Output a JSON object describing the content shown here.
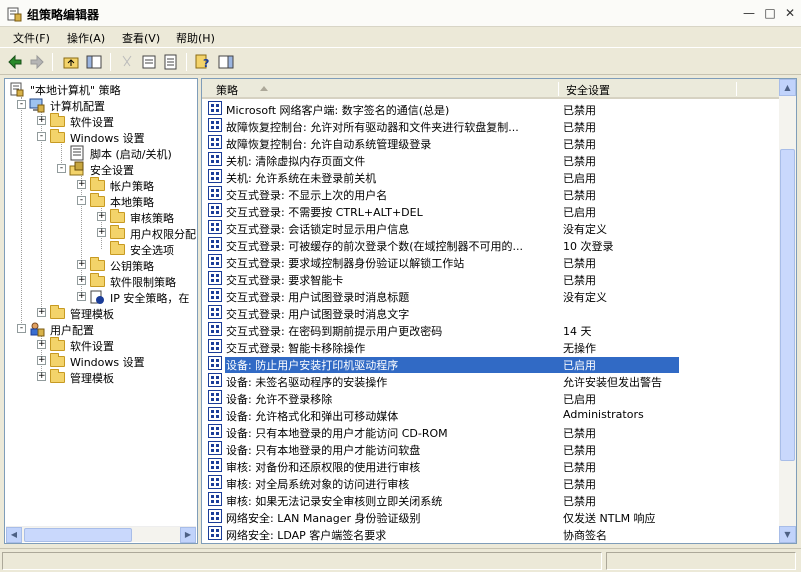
{
  "window": {
    "title": "组策略编辑器"
  },
  "menu": [
    {
      "label": "文件(F)"
    },
    {
      "label": "操作(A)"
    },
    {
      "label": "查看(V)"
    },
    {
      "label": "帮助(H)"
    }
  ],
  "tree": [
    {
      "label": "\"本地计算机\" 策略",
      "icon": "policy-icon"
    },
    {
      "label": "计算机配置",
      "icon": "computer-icon"
    },
    {
      "label": "软件设置",
      "icon": "folder-icon"
    },
    {
      "label": "Windows 设置",
      "icon": "folder-icon"
    },
    {
      "label": "脚本 (启动/关机)",
      "icon": "script-icon"
    },
    {
      "label": "安全设置",
      "icon": "security-icon"
    },
    {
      "label": "帐户策略",
      "icon": "folder-icon"
    },
    {
      "label": "本地策略",
      "icon": "folder-icon"
    },
    {
      "label": "审核策略",
      "icon": "folder-icon"
    },
    {
      "label": "用户权限分配",
      "icon": "folder-icon"
    },
    {
      "label": "安全选项",
      "icon": "folder-icon"
    },
    {
      "label": "公钥策略",
      "icon": "folder-icon"
    },
    {
      "label": "软件限制策略",
      "icon": "folder-icon"
    },
    {
      "label": "IP 安全策略，在",
      "icon": "ip-security-icon"
    },
    {
      "label": "管理模板",
      "icon": "folder-icon"
    },
    {
      "label": "用户配置",
      "icon": "user-icon"
    },
    {
      "label": "软件设置",
      "icon": "folder-icon"
    },
    {
      "label": "Windows 设置",
      "icon": "folder-icon"
    },
    {
      "label": "管理模板",
      "icon": "folder-icon"
    }
  ],
  "list": {
    "columns": {
      "policy": "策略",
      "setting": "安全设置"
    },
    "rows": [
      {
        "policy": "Microsoft 网络客户端: 数字签名的通信(总是)",
        "setting": "已禁用"
      },
      {
        "policy": "故障恢复控制台: 允许对所有驱动器和文件夹进行软盘复制...",
        "setting": "已禁用"
      },
      {
        "policy": "故障恢复控制台: 允许自动系统管理级登录",
        "setting": "已禁用"
      },
      {
        "policy": "关机: 清除虚拟内存页面文件",
        "setting": "已禁用"
      },
      {
        "policy": "关机: 允许系统在未登录前关机",
        "setting": "已启用"
      },
      {
        "policy": "交互式登录: 不显示上次的用户名",
        "setting": "已禁用"
      },
      {
        "policy": "交互式登录: 不需要按 CTRL+ALT+DEL",
        "setting": "已启用"
      },
      {
        "policy": "交互式登录: 会话锁定时显示用户信息",
        "setting": "没有定义"
      },
      {
        "policy": "交互式登录: 可被缓存的前次登录个数(在域控制器不可用的...",
        "setting": "10 次登录"
      },
      {
        "policy": "交互式登录: 要求域控制器身份验证以解锁工作站",
        "setting": "已禁用"
      },
      {
        "policy": "交互式登录: 要求智能卡",
        "setting": "已禁用"
      },
      {
        "policy": "交互式登录: 用户试图登录时消息标题",
        "setting": "没有定义"
      },
      {
        "policy": "交互式登录: 用户试图登录时消息文字",
        "setting": ""
      },
      {
        "policy": "交互式登录: 在密码到期前提示用户更改密码",
        "setting": "14 天"
      },
      {
        "policy": "交互式登录: 智能卡移除操作",
        "setting": "无操作"
      },
      {
        "policy": "设备: 防止用户安装打印机驱动程序",
        "setting": "已启用"
      },
      {
        "policy": "设备: 未签名驱动程序的安装操作",
        "setting": "允许安装但发出警告"
      },
      {
        "policy": "设备: 允许不登录移除",
        "setting": "已启用"
      },
      {
        "policy": "设备: 允许格式化和弹出可移动媒体",
        "setting": "Administrators"
      },
      {
        "policy": "设备: 只有本地登录的用户才能访问 CD-ROM",
        "setting": "已禁用"
      },
      {
        "policy": "设备: 只有本地登录的用户才能访问软盘",
        "setting": "已禁用"
      },
      {
        "policy": "审核: 对备份和还原权限的使用进行审核",
        "setting": "已禁用"
      },
      {
        "policy": "审核: 对全局系统对象的访问进行审核",
        "setting": "已禁用"
      },
      {
        "policy": "审核: 如果无法记录安全审核则立即关闭系统",
        "setting": "已禁用"
      },
      {
        "policy": "网络安全: LAN Manager 身份验证级别",
        "setting": "仅发送 NTLM 响应"
      },
      {
        "policy": "网络安全: LDAP 客户端签名要求",
        "setting": "协商签名"
      }
    ],
    "selected_index": 15
  },
  "colors": {
    "selection": "#316ac5",
    "pane_border": "#7f9db9",
    "chrome": "#ece9d8"
  }
}
